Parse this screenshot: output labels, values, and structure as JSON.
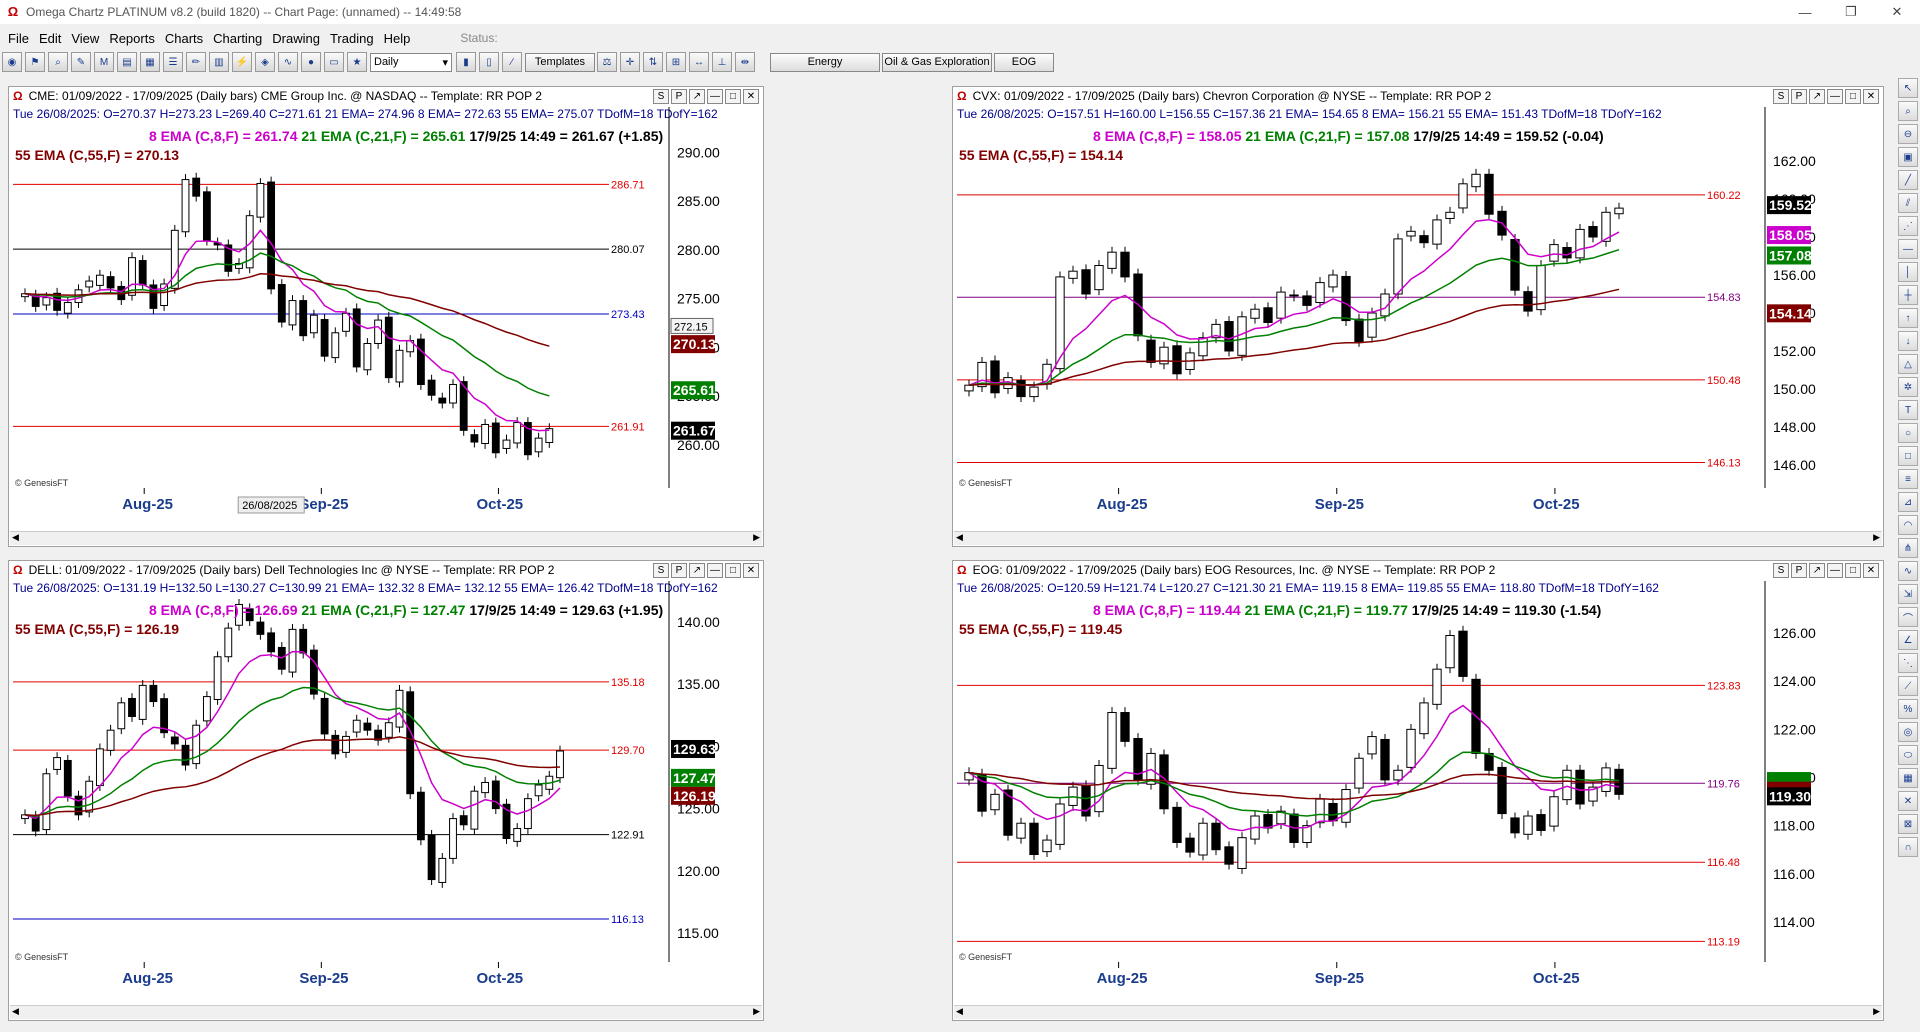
{
  "window": {
    "title": "Omega Chartz PLATINUM v8.2 (build 1820)  --  Chart Page: (unnamed) -- 14:49:58"
  },
  "menu": [
    "File",
    "Edit",
    "View",
    "Reports",
    "Charts",
    "Charting",
    "Drawing",
    "Trading",
    "Help"
  ],
  "status_label": "Status:",
  "toolbar": {
    "interval": "Daily",
    "templates": "Templates",
    "tabs": [
      "Energy",
      "Oil & Gas Exploration",
      "EOG"
    ]
  },
  "colors": {
    "ema8": "#cc00cc",
    "ema21": "#008000",
    "ema55": "#800000",
    "hline_red": "#e00000",
    "hline_blue": "#0000c0"
  },
  "charts": [
    {
      "id": "cme",
      "header": "CME: 01/09/2022 - 17/09/2025  (Daily bars)  CME Group Inc. @ NASDAQ  --  Template: RR POP 2",
      "ohlc": "Tue  26/08/2025:  O=270.37  H=273.23  L=269.40  C=271.61  21 EMA= 274.96  8 EMA= 272.63  55 EMA= 275.07  TDofM=18  TDofY=162",
      "ema8_label": "8 EMA (C,8,F) = 261.74",
      "ema21_label": "21 EMA (C,21,F) = 265.61",
      "last_label": "17/9/25 14:49 = 261.67 (+1.85)",
      "ema55_label": "55 EMA (C,55,F) = 270.13",
      "credit": "© GenesisFT",
      "date_tag": "26/08/2025",
      "cursor_price": "272.15",
      "chart_data": {
        "type": "candlestick",
        "ylim": [
          256,
          293
        ],
        "yticks": [
          "290.00",
          "285.00",
          "280.00",
          "275.00",
          "270.00",
          "265.00",
          "260.00"
        ],
        "xticks": [
          "Aug-25",
          "Sep-25",
          "Oct-25"
        ],
        "hlines": [
          {
            "value": 286.71,
            "label": "286.71",
            "color": "red"
          },
          {
            "value": 280.07,
            "label": "280.07",
            "color": "black"
          },
          {
            "value": 273.43,
            "label": "273.43",
            "color": "blue"
          },
          {
            "value": 261.91,
            "label": "261.91",
            "color": "red"
          }
        ],
        "badges": [
          {
            "value": 270.13,
            "label": "270.13",
            "color": "#800000"
          },
          {
            "value": 265.61,
            "label": "265.61",
            "color": "#008000"
          },
          {
            "value": 261.67,
            "label": "261.67",
            "color": "#000000"
          }
        ],
        "close": [
          275.5,
          274.2,
          275.1,
          273.8,
          274.6,
          275.9,
          276.8,
          277.4,
          276.1,
          274.9,
          279.2,
          276.4,
          274.0,
          276.5,
          282.0,
          287.2,
          285.5,
          281.0,
          280.5,
          277.8,
          278.6,
          283.5,
          286.8,
          276.0,
          272.6,
          274.8,
          271.2,
          273.3,
          269.1,
          271.5,
          273.5,
          268.0,
          270.4,
          272.8,
          266.9,
          269.7,
          270.7,
          266.2,
          265.1,
          264.3,
          266.2,
          261.5,
          260.3,
          262.1,
          259.2,
          260.5,
          262.3,
          259.0,
          260.7,
          261.67
        ]
      }
    },
    {
      "id": "cvx",
      "header": "CVX: 01/09/2022 - 17/09/2025  (Daily bars)  Chevron Corporation @ NYSE  --  Template: RR POP 2",
      "ohlc": "Tue  26/08/2025:  O=157.51  H=160.00  L=156.55  C=157.36  21 EMA= 154.65  8 EMA= 156.21  55 EMA= 151.43  TDofM=18  TDofY=162",
      "ema8_label": "8 EMA (C,8,F) = 158.05",
      "ema21_label": "21 EMA (C,21,F) = 157.08",
      "last_label": "17/9/25 14:49 = 159.52 (-0.04)",
      "ema55_label": "55 EMA (C,55,F) = 154.14",
      "credit": "© GenesisFT",
      "chart_data": {
        "type": "candlestick",
        "ylim": [
          145,
          164
        ],
        "yticks": [
          "162.00",
          "160.00",
          "158.00",
          "156.00",
          "154.00",
          "152.00",
          "150.00",
          "148.00",
          "146.00"
        ],
        "xticks": [
          "Aug-25",
          "Sep-25",
          "Oct-25"
        ],
        "hlines": [
          {
            "value": 160.22,
            "label": "160.22",
            "color": "red"
          },
          {
            "value": 154.83,
            "label": "154.83",
            "color": "purple"
          },
          {
            "value": 150.48,
            "label": "150.48",
            "color": "red"
          },
          {
            "value": 146.13,
            "label": "146.13",
            "color": "red"
          }
        ],
        "badges": [
          {
            "value": 159.52,
            "label": "159.52",
            "color": "#000000"
          },
          {
            "value": 158.05,
            "label": "158.05",
            "color": "#cc00cc"
          },
          {
            "value": 157.08,
            "label": "157.08",
            "color": "#008000"
          },
          {
            "value": 154.14,
            "label": "154.14",
            "color": "#800000"
          }
        ],
        "close": [
          150.2,
          151.4,
          149.8,
          150.6,
          149.6,
          150.1,
          151.3,
          155.9,
          156.2,
          155.0,
          156.5,
          157.2,
          155.9,
          152.8,
          151.4,
          152.2,
          150.8,
          151.9,
          152.7,
          153.4,
          152.0,
          153.8,
          154.2,
          153.5,
          155.1,
          154.9,
          154.4,
          155.6,
          156.0,
          153.6,
          152.5,
          154.0,
          155.0,
          157.9,
          158.3,
          157.7,
          158.9,
          159.3,
          160.8,
          161.3,
          159.2,
          158.1,
          155.2,
          154.1,
          156.5,
          157.6,
          156.9,
          158.4,
          158.0,
          159.3,
          159.52
        ]
      }
    },
    {
      "id": "dell",
      "header": "DELL: 01/09/2022 - 17/09/2025  (Daily bars)  Dell Technologies Inc @ NYSE  --  Template: RR POP 2",
      "ohlc": "Tue  26/08/2025:  O=131.19  H=132.50  L=130.27  C=130.99  21 EMA= 132.32  8 EMA= 132.12  55 EMA= 126.42  TDofM=18  TDofY=162",
      "ema8_label": "8 EMA (C,8,F) = 126.69",
      "ema21_label": "21 EMA (C,21,F) = 127.47",
      "last_label": "17/9/25 14:49 = 129.63 (+1.95)",
      "ema55_label": "55 EMA (C,55,F) = 126.19",
      "credit": "© GenesisFT",
      "chart_data": {
        "type": "candlestick",
        "ylim": [
          113,
          142
        ],
        "yticks": [
          "140.00",
          "135.00",
          "130.00",
          "125.00",
          "120.00",
          "115.00"
        ],
        "xticks": [
          "Aug-25",
          "Sep-25",
          "Oct-25"
        ],
        "hlines": [
          {
            "value": 135.18,
            "label": "135.18",
            "color": "red"
          },
          {
            "value": 129.7,
            "label": "129.70",
            "color": "red"
          },
          {
            "value": 122.91,
            "label": "122.91",
            "color": "black"
          },
          {
            "value": 116.13,
            "label": "116.13",
            "color": "blue"
          }
        ],
        "badges": [
          {
            "value": 129.63,
            "label": "129.63",
            "color": "#000000"
          },
          {
            "value": 127.47,
            "label": "127.47",
            "color": "#008000"
          },
          {
            "value": 126.19,
            "label": "126.19",
            "color": "#800000"
          }
        ],
        "close": [
          124.5,
          123.2,
          127.8,
          129.1,
          126.0,
          124.5,
          127.2,
          129.8,
          131.3,
          133.5,
          132.4,
          134.9,
          133.6,
          131.1,
          130.2,
          128.5,
          131.7,
          134.0,
          137.2,
          139.5,
          141.4,
          140.1,
          139.0,
          137.6,
          136.2,
          139.4,
          137.5,
          134.2,
          131.0,
          129.4,
          130.8,
          132.1,
          131.3,
          130.5,
          131.9,
          134.5,
          126.2,
          122.5,
          119.3,
          121.0,
          124.2,
          123.7,
          126.4,
          127.1,
          125.0,
          122.6,
          123.4,
          125.8,
          126.9,
          127.6,
          129.63
        ]
      }
    },
    {
      "id": "eog",
      "header": "EOG: 01/09/2022 - 17/09/2025  (Daily bars)  EOG Resources, Inc. @ NYSE  --  Template: RR POP 2",
      "ohlc": "Tue  26/08/2025:  O=120.59  H=121.74  L=120.27  C=121.30  21 EMA= 119.15  8 EMA= 119.85  55 EMA= 118.80  TDofM=18  TDofY=162",
      "ema8_label": "8 EMA (C,8,F) = 119.44",
      "ema21_label": "21 EMA (C,21,F) = 119.77",
      "last_label": "17/9/25 14:49 = 119.30 (-1.54)",
      "ema55_label": "55 EMA (C,55,F) = 119.45",
      "credit": "© GenesisFT",
      "chart_data": {
        "type": "candlestick",
        "ylim": [
          112.5,
          127.5
        ],
        "yticks": [
          "126.00",
          "124.00",
          "122.00",
          "120.00",
          "118.00",
          "116.00",
          "114.00"
        ],
        "xticks": [
          "Aug-25",
          "Sep-25",
          "Oct-25"
        ],
        "hlines": [
          {
            "value": 123.83,
            "label": "123.83",
            "color": "red"
          },
          {
            "value": 119.76,
            "label": "119.76",
            "color": "purple"
          },
          {
            "value": 116.48,
            "label": "116.48",
            "color": "red"
          },
          {
            "value": 113.19,
            "label": "113.19",
            "color": "red"
          }
        ],
        "badges": [
          {
            "value": 119.77,
            "label": "",
            "color": "#008000"
          },
          {
            "value": 119.45,
            "label": "",
            "color": "#800000"
          },
          {
            "value": 119.3,
            "label": "119.30",
            "color": "#000000"
          }
        ],
        "close": [
          120.2,
          118.6,
          119.3,
          117.6,
          118.1,
          116.8,
          117.4,
          118.9,
          119.6,
          118.4,
          120.5,
          122.7,
          121.5,
          119.9,
          121.0,
          118.7,
          117.3,
          116.9,
          118.1,
          117.0,
          116.4,
          117.5,
          118.4,
          117.9,
          118.6,
          117.3,
          118.0,
          119.1,
          118.2,
          119.5,
          120.8,
          121.7,
          119.9,
          120.3,
          122.0,
          123.1,
          124.5,
          125.9,
          124.2,
          121.0,
          120.3,
          118.5,
          117.7,
          118.4,
          117.8,
          119.2,
          120.3,
          118.9,
          119.6,
          120.4,
          119.3
        ]
      }
    }
  ]
}
